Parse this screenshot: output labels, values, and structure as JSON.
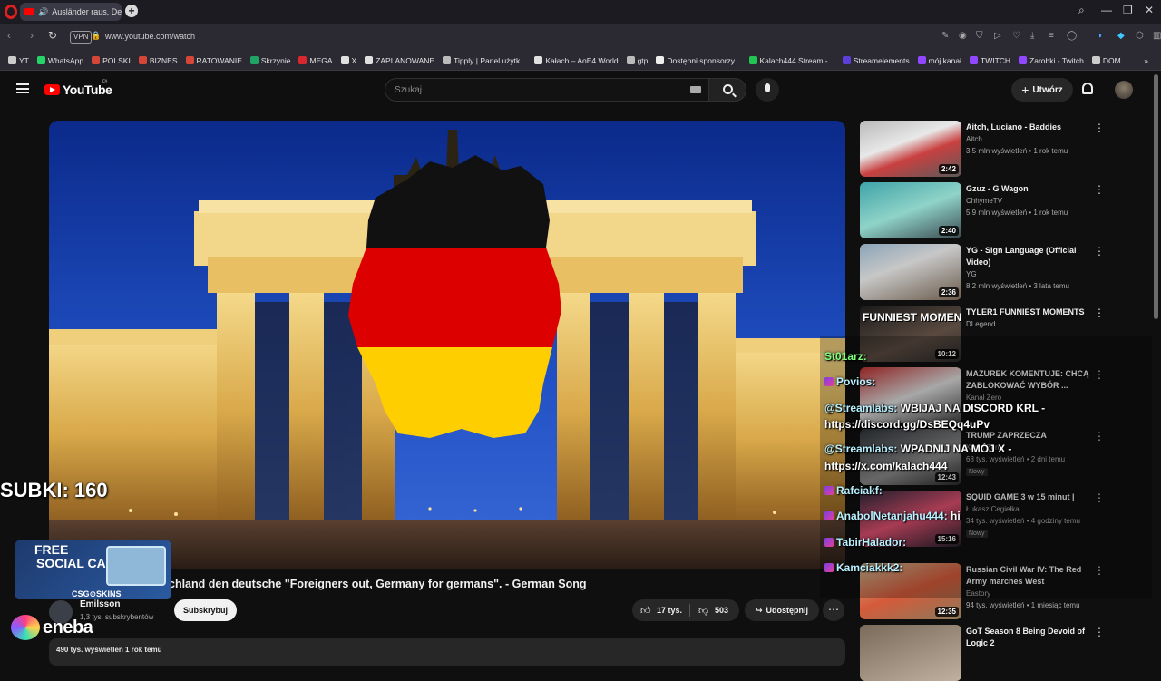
{
  "browser": {
    "tab_title": "Ausländer raus, Deuts",
    "url": "www.youtube.com/watch",
    "vpn_label": "VPN",
    "bookmarks": [
      {
        "label": "YT",
        "color": "#cccccc"
      },
      {
        "label": "WhatsApp",
        "color": "#25d366"
      },
      {
        "label": "POLSKI",
        "color": "#d44638"
      },
      {
        "label": "BIZNES",
        "color": "#d44638"
      },
      {
        "label": "RATOWANIE",
        "color": "#d44638"
      },
      {
        "label": "Skrzynie",
        "color": "#1fa463"
      },
      {
        "label": "MEGA",
        "color": "#d9272e"
      },
      {
        "label": "X",
        "color": "#e0e0e0"
      },
      {
        "label": "ZAPLANOWANE",
        "color": "#e0e0e0"
      },
      {
        "label": "Tipply | Panel użytk...",
        "color": "#bbbbbb"
      },
      {
        "label": "Kałach – AoE4 World",
        "color": "#e0e0e0"
      },
      {
        "label": "gtp",
        "color": "#bbbbbb"
      },
      {
        "label": "Dostępni sponsorzy...",
        "color": "#eeeeee"
      },
      {
        "label": "Kalach444 Stream -...",
        "color": "#23c552"
      },
      {
        "label": "Streamelements",
        "color": "#5b3fd6"
      },
      {
        "label": "mój kanał",
        "color": "#9146ff"
      },
      {
        "label": "TWITCH",
        "color": "#9146ff"
      },
      {
        "label": "Zarobki - Twitch",
        "color": "#9146ff"
      },
      {
        "label": "DOM",
        "color": "#cccccc"
      }
    ]
  },
  "youtube": {
    "logo_text": "YouTube",
    "region": "PL",
    "search_placeholder": "Szukaj",
    "create_label": "Utwórz"
  },
  "video": {
    "title_visible": "chland den deutsche \"Foreigners out, Germany for germans\". - German Song",
    "channel_name": "Emilsson",
    "subscribers": "1,3 tys. subskrybentów",
    "subscribe_label": "Subskrybuj",
    "likes": "17 tys.",
    "dislikes": "503",
    "share_label": "Udostępnij",
    "view_stats": "490 tys. wyświetleń  1 rok temu"
  },
  "recommendations": [
    {
      "title": "Aitch, Luciano - Baddies",
      "channel": "Aitch",
      "meta": "3,5 mln wyświetleń • 1 rok temu",
      "duration": "2:42",
      "badge": ""
    },
    {
      "title": "Gzuz - G Wagon",
      "channel": "ChhymeTV",
      "meta": "5,9 mln wyświetleń • 1 rok temu",
      "duration": "2:40",
      "badge": ""
    },
    {
      "title": "YG - Sign Language (Official Video)",
      "channel": "YG",
      "meta": "8,2 mln wyświetleń • 3 lata temu",
      "duration": "2:36",
      "badge": ""
    },
    {
      "title": "TYLER1 FUNNIEST MOMENTS",
      "channel": "DLegend",
      "meta": "",
      "duration": "10:12",
      "badge": ""
    },
    {
      "title": "MAZUREK KOMENTUJE: CHCĄ ZABLOKOWAĆ WYBÓR ...",
      "channel": "Kanał Zero",
      "meta": "",
      "duration": "",
      "badge": ""
    },
    {
      "title": "TRUMP ZAPRZECZA",
      "channel": "Kanał Zero",
      "meta": "68 tys. wyświetleń • 2 dni temu",
      "duration": "12:43",
      "badge": "Nowy"
    },
    {
      "title": "SQUID GAME 3 w 15 minut |",
      "channel": "Łukasz Cegiełka",
      "meta": "34 tys. wyświetleń • 4 godziny temu",
      "duration": "15:16",
      "badge": "Nowy"
    },
    {
      "title": "Russian Civil War IV: The Red Army marches West",
      "channel": "Eastory",
      "meta": "94 tys. wyświetleń • 1 miesiąc temu",
      "duration": "12:35",
      "badge": ""
    },
    {
      "title": "GoT Season 8 Being Devoid of Logic 2",
      "channel": "",
      "meta": "",
      "duration": "",
      "badge": ""
    }
  ],
  "overlays": {
    "subs": "SUBKI: 160",
    "ad_line1": "FREE",
    "ad_line2": "SOCIAL CASES",
    "ad_brand": "CSG⊙SKINS",
    "eneba": "eneba",
    "thumb4_text": "FUNNIEST MOMENTS"
  },
  "chat": [
    {
      "user": "St01arz:",
      "text": "",
      "green": true
    },
    {
      "user": "Povios:",
      "text": ""
    },
    {
      "user": "@Streamlabs:",
      "text": "WBIJAJ NA DISCORD KRL -"
    },
    {
      "user": "",
      "text": "https://discord.gg/DsBEQq4uPv"
    },
    {
      "user": "@Streamlabs:",
      "text": "WPADNIJ NA MÓJ X -"
    },
    {
      "user": "",
      "text": "https://x.com/kalach444"
    },
    {
      "user": "Rafciakf:",
      "text": ""
    },
    {
      "user": "AnabolNetanjahu444:",
      "text": "hi"
    },
    {
      "user": "TabirHalador:",
      "text": ""
    },
    {
      "user": "Kamciakkk2:",
      "text": ""
    }
  ],
  "colors": {
    "yt_red": "#ff0000",
    "flag_black": "#111111",
    "flag_red": "#dd0000",
    "flag_gold": "#ffce00"
  }
}
